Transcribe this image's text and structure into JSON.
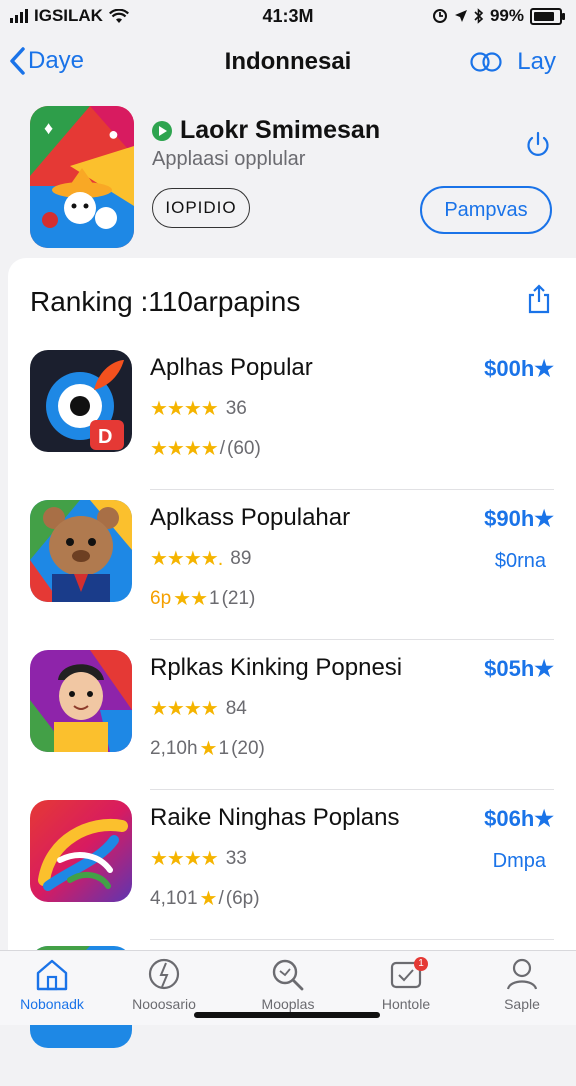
{
  "status_bar": {
    "carrier": "IGSILAK",
    "time": "41:3M",
    "battery": "99%"
  },
  "nav": {
    "back_label": "Daye",
    "title": "Indonnesai",
    "right_label": "Lay"
  },
  "featured": {
    "name": "Laokr Smimesan",
    "subtitle": "Applaasi opplular",
    "tag_button": "IOPIDIO",
    "action_button": "Pampvas"
  },
  "section": {
    "title": "Ranking :110arpapins"
  },
  "apps": [
    {
      "name": "Aplhas Popular",
      "rating_a": "36",
      "rating_b": "(60)",
      "price": "$00h★",
      "sub": ""
    },
    {
      "name": "Aplkass Populahar",
      "rating_a": "89",
      "rating_b": "(21)",
      "prefix_b": "6p",
      "price": "$90h★",
      "sub": "$0rna"
    },
    {
      "name": "Rplkas Kinking Popnesi",
      "rating_a": "84",
      "rating_b": "(20)",
      "prefix_b": "2,10h",
      "price": "$05h★",
      "sub": ""
    },
    {
      "name": "Raike Ninghas Poplans",
      "rating_a": "33",
      "rating_b": "(6p)",
      "prefix_b": "4,101",
      "price": "$06h★",
      "sub": "Dmpa"
    }
  ],
  "tabs": [
    {
      "label": "Nobonadk",
      "icon": "home-icon",
      "active": true
    },
    {
      "label": "Nooosario",
      "icon": "compass-icon",
      "active": false
    },
    {
      "label": "Mooplas",
      "icon": "search-icon",
      "active": false
    },
    {
      "label": "Hontole",
      "icon": "updates-icon",
      "active": false,
      "badge": "1"
    },
    {
      "label": "Saple",
      "icon": "profile-icon",
      "active": false
    }
  ],
  "colors": {
    "accent": "#1a73e8",
    "star": "#f5b400",
    "background": "#f2f2f4"
  }
}
